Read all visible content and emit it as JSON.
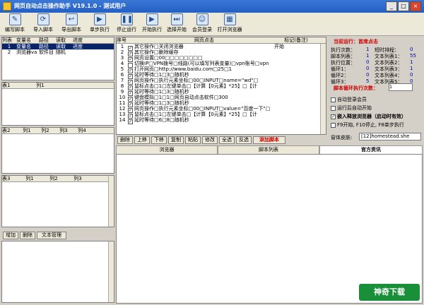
{
  "window": {
    "title": "网页自动点击操作助手 V19.1.0 - 测试用户",
    "min": "_",
    "max": "□",
    "close": "×"
  },
  "toolbar": [
    {
      "label": "编写脚本",
      "icon": "✎"
    },
    {
      "label": "导入脚本",
      "icon": "⟳"
    },
    {
      "label": "导出脚本",
      "icon": "↩"
    },
    {
      "label": "单步执行",
      "icon": "▶"
    },
    {
      "label": "停止运行",
      "icon": "❚❚"
    },
    {
      "label": "开始执行",
      "icon": "▶"
    },
    {
      "label": "选择开始",
      "icon": "⏭"
    },
    {
      "label": "会员登录",
      "icon": "☺"
    },
    {
      "label": "打开浏览器",
      "icon": "▦"
    }
  ],
  "list_table": {
    "headers": [
      "列表",
      "变量名",
      "路径",
      "读取",
      "进度"
    ],
    "rows": [
      [
        "1",
        "变量名",
        "路径",
        "读取",
        "进度"
      ],
      [
        "2",
        "浏览器va",
        "软件目",
        "随机",
        ""
      ]
    ]
  },
  "table1": {
    "headers": [
      "表1",
      "列1"
    ]
  },
  "table2": {
    "headers": [
      "表2",
      "列1",
      "列2",
      "列3",
      "列4"
    ]
  },
  "table3": {
    "headers": [
      "表3",
      "列1",
      "列2",
      "列3"
    ]
  },
  "bottom_left_buttons": [
    "增加",
    "删除",
    "文本管理"
  ],
  "script": {
    "headers": [
      "序号",
      "",
      "网页点击",
      "标记(备注)"
    ],
    "rows": [
      {
        "n": "1",
        "c": "✓",
        "text": "其它操作□关闭浏览器",
        "mark": "开始"
      },
      {
        "n": "2",
        "c": "✓",
        "text": "其它操作□删除缓存",
        "mark": ""
      },
      {
        "n": "3",
        "c": "✓",
        "text": "网页设置□00□□□□□□□□",
        "mark": ""
      },
      {
        "n": "4",
        "c": "",
        "text": "切换IP□VPN拨号□线路(可以填写列表变量)□vpn账号□vpn",
        "mark": ""
      },
      {
        "n": "5",
        "c": "✓",
        "text": "打开网页□http://www.baidu.com□25□1",
        "mark": ""
      },
      {
        "n": "6",
        "c": "✓",
        "text": "延时等待□1□3□随机秒",
        "mark": ""
      },
      {
        "n": "7",
        "c": "✓",
        "text": "网页操作□执行元素坐标□00□INPUT□name=\"wd\"□",
        "mark": ""
      },
      {
        "n": "8",
        "c": "✓",
        "text": "鼠标点击□1□左键单击□【计算【0元素】*25】□【计",
        "mark": ""
      },
      {
        "n": "9",
        "c": "✓",
        "text": "延时等待□1□3□随机秒",
        "mark": ""
      },
      {
        "n": "10",
        "c": "✓",
        "text": "键盘模拟□1□1□网页自动点击软件□300",
        "mark": ""
      },
      {
        "n": "11",
        "c": "✓",
        "text": "延时等待□1□3□随机秒",
        "mark": ""
      },
      {
        "n": "12",
        "c": "✓",
        "text": "网页操作□执行元素坐标□00□INPUT□value=\"百度一下\"□",
        "mark": ""
      },
      {
        "n": "13",
        "c": "✓",
        "text": "鼠标点击□1□左键单击□【计算【0元素】*25】□【计",
        "mark": ""
      },
      {
        "n": "14",
        "c": "✓",
        "text": "延时等待□6□8□随机秒",
        "mark": ""
      }
    ]
  },
  "script_buttons": [
    "删除",
    "上移",
    "下移",
    "复制",
    "粘贴",
    "修改",
    "全选",
    "反选",
    "添加脚本"
  ],
  "tabs": [
    "浏览器",
    "脚本列表",
    "官方资讯"
  ],
  "status": {
    "current": "当前运行：首席点击",
    "items": [
      {
        "label": "执行次数：",
        "value": "1"
      },
      {
        "label": "短时排程：",
        "value": "0"
      },
      {
        "label": "脚本列表：",
        "value": "1"
      },
      {
        "label": "文本列表1：",
        "value": "55"
      },
      {
        "label": "执行位置：",
        "value": "0"
      },
      {
        "label": "文本列表2：",
        "value": "1"
      },
      {
        "label": "循环1：",
        "value": "0"
      },
      {
        "label": "文本列表3：",
        "value": "1"
      },
      {
        "label": "循环2：",
        "value": "0"
      },
      {
        "label": "文本列表4：",
        "value": "0"
      },
      {
        "label": "循环3：",
        "value": "5"
      },
      {
        "label": "文本列表5：",
        "value": "0"
      }
    ],
    "loop_label": "脚本循环执行次数：",
    "loop_value": "1",
    "options": [
      {
        "label": "自动登录会员",
        "checked": false
      },
      {
        "label": "运行后自动开始",
        "checked": false
      },
      {
        "label": "嵌入释放浏览器（启动时有效）",
        "checked": true
      },
      {
        "label": "F9开始, F10停止, F8单步执行",
        "checked": false
      }
    ],
    "skin_label": "窗体皮肤:",
    "skin_value": "[12]homestead.she"
  },
  "logo": {
    "text": "神奇下载"
  }
}
